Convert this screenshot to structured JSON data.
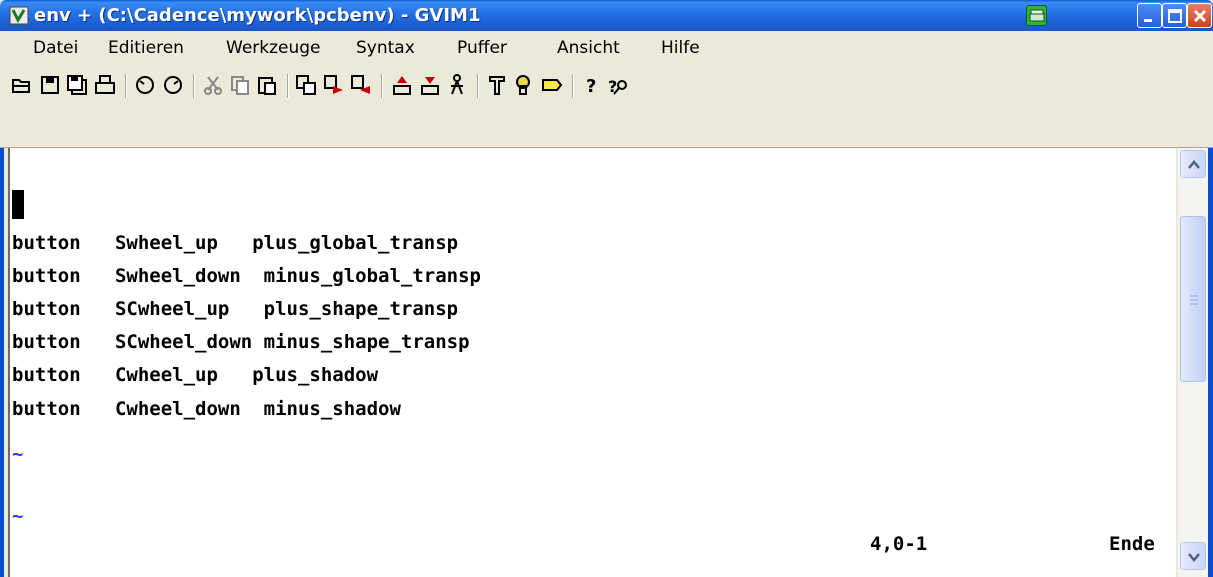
{
  "window": {
    "title": "env + (C:\\Cadence\\mywork\\pcbenv) - GVIM1"
  },
  "menu": [
    {
      "label": "Datei"
    },
    {
      "label": "Editieren"
    },
    {
      "label": "Werkzeuge"
    },
    {
      "label": "Syntax"
    },
    {
      "label": "Puffer"
    },
    {
      "label": "Ansicht"
    },
    {
      "label": "Hilfe"
    }
  ],
  "toolbar_icons": [
    "open-icon",
    "save-icon",
    "save-all-icon",
    "print-icon",
    "undo-icon",
    "redo-icon",
    "cut-icon",
    "copy-icon",
    "paste-icon",
    "replace-icon",
    "find-next-icon",
    "find-prev-icon",
    "load-session-icon",
    "save-session-icon",
    "run-script-icon",
    "make-icon",
    "build-tags-icon",
    "jump-to-tag-icon",
    "help-icon",
    "find-help-icon"
  ],
  "editor": {
    "lines": [
      "",
      "",
      "button   Swheel_up   plus_global_transp",
      "button   Swheel_down  minus_global_transp",
      "button   SCwheel_up   plus_shape_transp",
      "button   SCwheel_down minus_shape_transp",
      "button   Cwheel_up   plus_shadow",
      "button   Cwheel_down  minus_shadow"
    ],
    "tildes": [
      "~",
      "~"
    ]
  },
  "status": {
    "position": "4,0-1",
    "scroll": "Ende"
  },
  "colors": {
    "titlebar": "#2673e8",
    "tilde": "#2240d0",
    "close_button": "#c8451f"
  }
}
